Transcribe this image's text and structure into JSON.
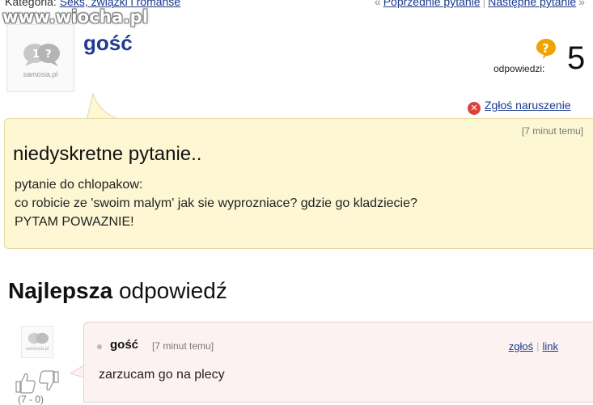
{
  "header": {
    "category_label": "Kategoria:",
    "category_link": "Seks, związki i romanse",
    "prev_link": "Poprzednie pytanie",
    "next_link": "Następne pytanie"
  },
  "watermark": "www.wiocha.pl",
  "question": {
    "avatar_brand": "samosia.pl",
    "username": "gość",
    "answers_label": "odpowiedzi:",
    "answers_count": "5",
    "report_label": "Zgłoś naruszenie",
    "time": "[7 minut temu]",
    "title": "niedyskretne pytanie..",
    "body_lines": [
      "pytanie do chlopakow:",
      "co robicie ze 'swoim malym' jak sie wyprozniace? gdzie go kladziecie?",
      "PYTAM POWAZNIE!"
    ]
  },
  "best_answer": {
    "heading_bold": "Najlepsza",
    "heading_rest": "odpowiedź",
    "avatar_brand": "samosia.pl",
    "votes": "(7 - 0)",
    "username": "gość",
    "time": "[7 minut temu]",
    "report_link": "zgłoś",
    "link_link": "link",
    "text": "zarzucam go na plecy"
  },
  "colors": {
    "question_bg": "#fdf7d3",
    "answer_bg": "#fdf2f2",
    "link": "#1a3a8c",
    "username": "#1d3c8f",
    "report_icon": "#d9423a",
    "answers_icon": "#f0a400"
  }
}
